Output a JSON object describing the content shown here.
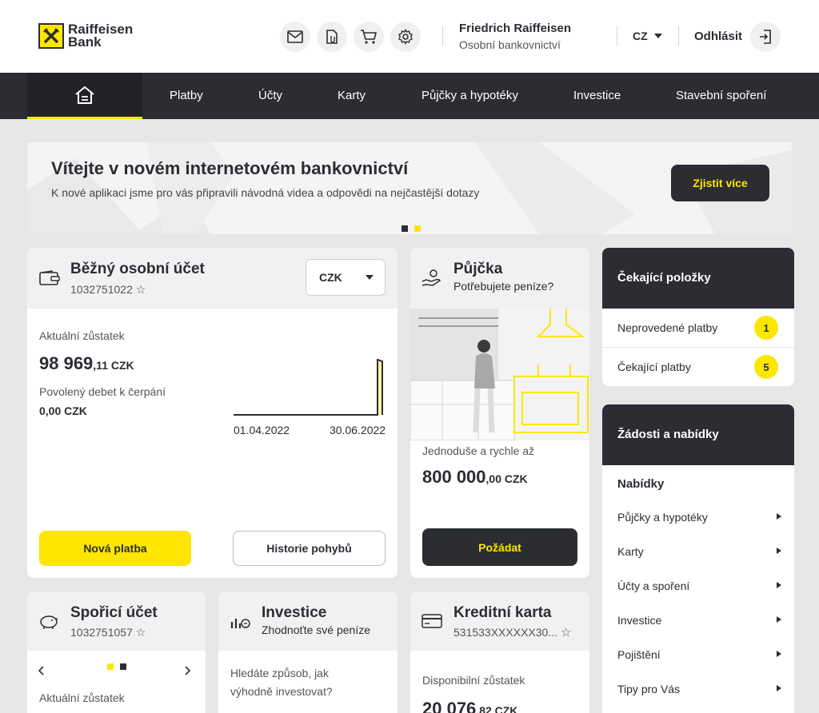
{
  "header": {
    "logo_line1": "Raiffeisen",
    "logo_line2": "Bank",
    "user_name": "Friedrich Raiffeisen",
    "user_subtitle": "Osobní bankovnictví",
    "language": "CZ",
    "logout_label": "Odhlásit",
    "icons": [
      "mail-icon",
      "documents-icon",
      "cart-icon",
      "gear-icon"
    ]
  },
  "nav": {
    "items": [
      "Platby",
      "Účty",
      "Karty",
      "Půjčky a hypotéky",
      "Investice",
      "Stavební spoření"
    ]
  },
  "banner": {
    "title": "Vítejte v novém internetovém bankovnictví",
    "subtitle": "K nové aplikaci jsme pro vás připravili návodná videa a odpovědi na nejčastější dotazy",
    "button_label": "Zjistit více",
    "slides": 2,
    "active_slide": 2
  },
  "current_account": {
    "title": "Běžný osobní účet",
    "number": "1032751022 ☆",
    "currency": "CZK",
    "balance_label": "Aktuální zůstatek",
    "balance_main": "98 969",
    "balance_cents": ",11 CZK",
    "overdraft_label": "Povolený debet k čerpání",
    "overdraft_value": "0,00 CZK",
    "chart_start": "01.04.2022",
    "chart_end": "30.06.2022",
    "new_payment_label": "Nová platba",
    "history_label": "Historie pohybů"
  },
  "loan": {
    "title": "Půjčka",
    "subtitle": "Potřebujete peníze?",
    "desc": "Jednoduše a rychle až",
    "amount_main": "800 000",
    "amount_cents": ",00 CZK",
    "button_label": "Požádat"
  },
  "pending": {
    "title": "Čekající položky",
    "rows": [
      {
        "label": "Neprovedené platby",
        "count": "1"
      },
      {
        "label": "Čekající platby",
        "count": "5"
      }
    ]
  },
  "requests": {
    "title": "Žádosti a nabídky",
    "section_label": "Nabídky",
    "items": [
      "Půjčky a hypotéky",
      "Karty",
      "Účty a spoření",
      "Investice",
      "Pojištění",
      "Tipy pro Vás"
    ]
  },
  "savings": {
    "title": "Spořicí účet",
    "number": "1032751057 ☆",
    "balance_label": "Aktuální zůstatek"
  },
  "investment": {
    "title": "Investice",
    "subtitle": "Zhodnoťte své peníze",
    "text_line1": "Hledáte způsob, jak",
    "text_line2": "výhodně investovat?"
  },
  "credit_card": {
    "title": "Kreditní karta",
    "number": "531533XXXXXX30...",
    "star": "☆",
    "balance_label": "Disponibilní zůstatek",
    "balance_main": "20 076",
    "balance_cents": ",82 CZK"
  },
  "colors": {
    "accent": "#fee600",
    "dark": "#2b2d33",
    "background": "#e7e7e7"
  }
}
